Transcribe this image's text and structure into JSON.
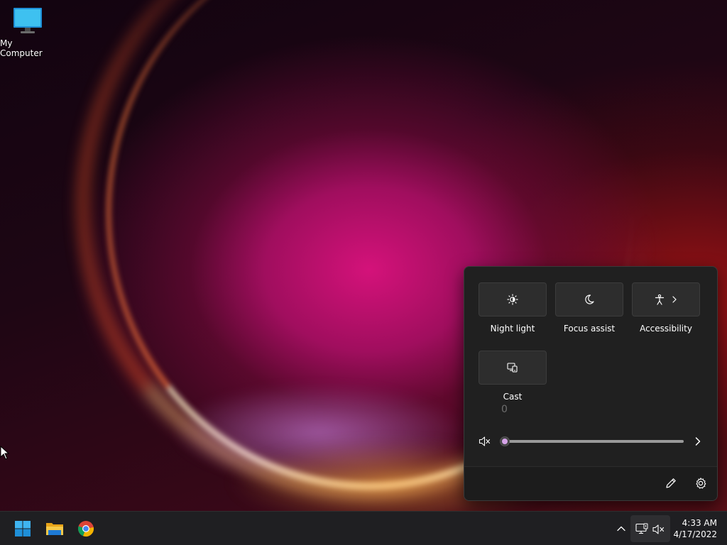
{
  "desktop": {
    "icons": [
      {
        "label": "My Computer",
        "icon": "monitor-icon"
      }
    ]
  },
  "quick_settings": {
    "tiles": [
      {
        "label": "Night light",
        "icon": "night-light-icon"
      },
      {
        "label": "Focus assist",
        "icon": "moon-icon"
      },
      {
        "label": "Accessibility",
        "icon": "accessibility-icon"
      },
      {
        "label": "Cast",
        "icon": "cast-icon"
      }
    ],
    "cast_subtext": "0",
    "volume": {
      "level": 0,
      "muted": true
    },
    "footer": {
      "edit_icon": "pencil-icon",
      "settings_icon": "gear-icon"
    }
  },
  "taskbar": {
    "apps": [
      {
        "name": "Start",
        "icon": "windows-logo-icon"
      },
      {
        "name": "File Explorer",
        "icon": "folder-icon"
      },
      {
        "name": "Google Chrome",
        "icon": "chrome-icon"
      }
    ],
    "tray": {
      "network_icon": "network-icon",
      "volume_icon": "speaker-muted-icon"
    },
    "clock": {
      "time": "4:33 AM",
      "date": "4/17/2022"
    }
  },
  "colors": {
    "panel_bg": "#202020",
    "tile_bg": "#2d2d2d",
    "accent_thumb": "#d6a3e8",
    "taskbar_bg": "#1f1f22"
  }
}
